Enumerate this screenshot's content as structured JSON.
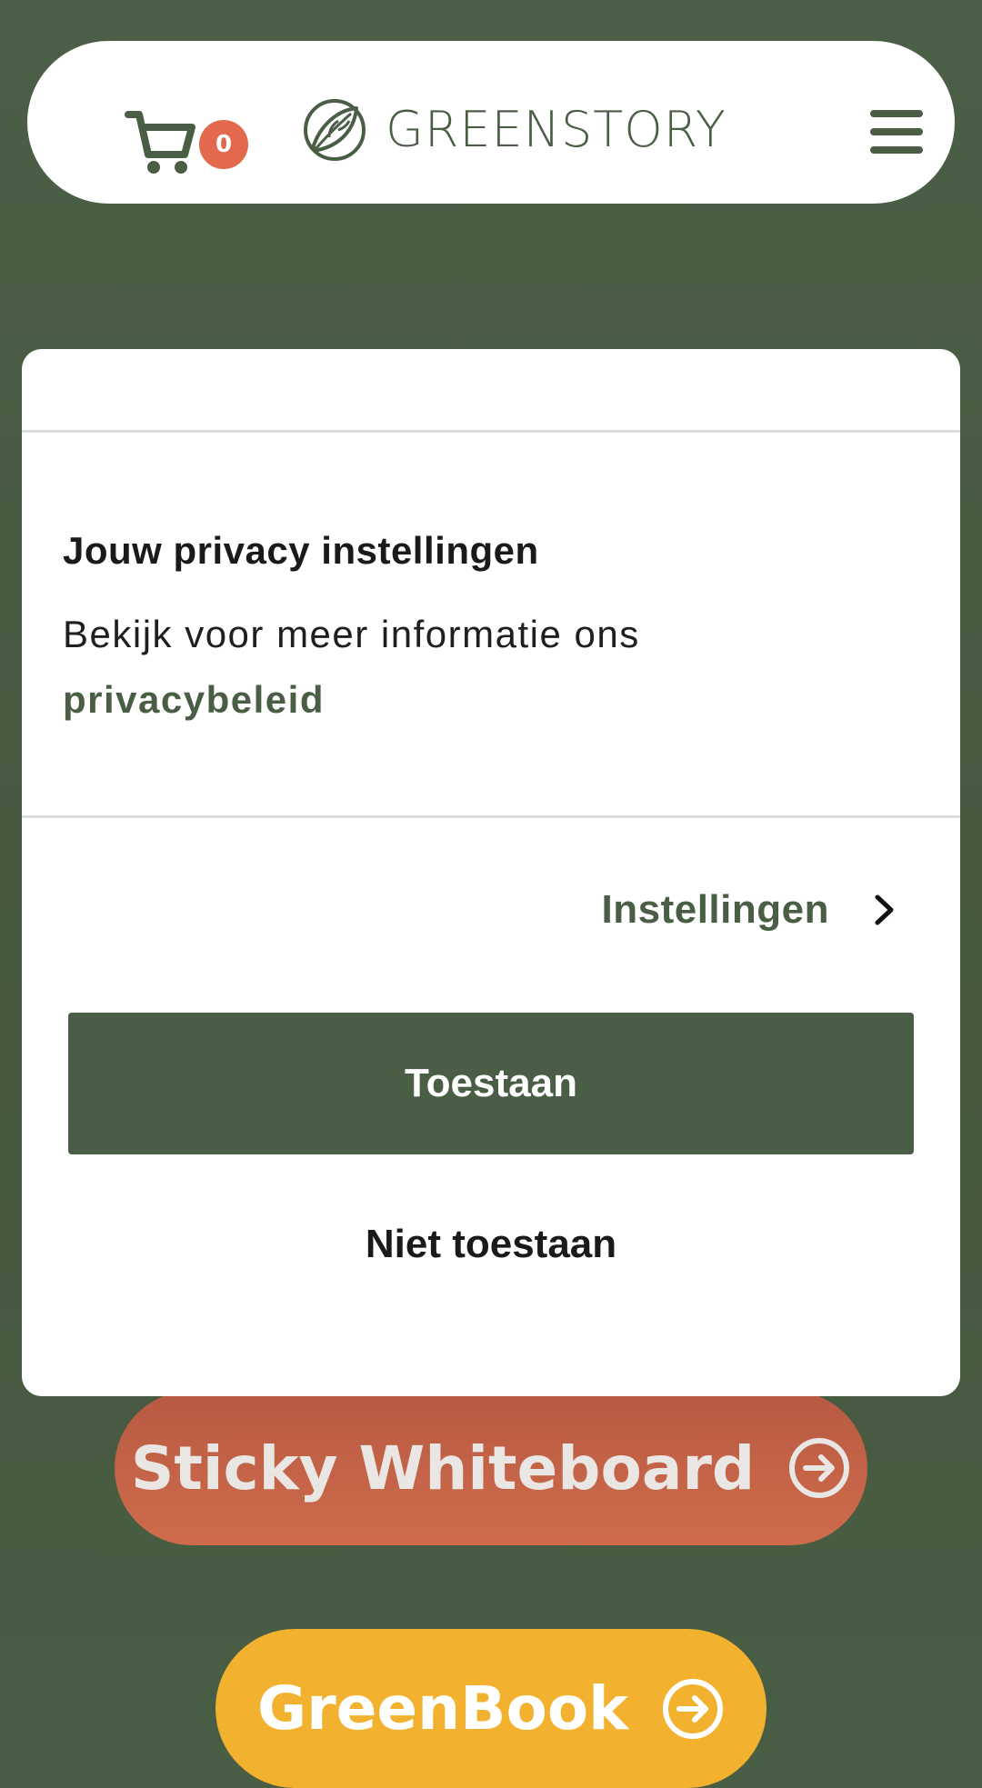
{
  "header": {
    "cart": {
      "count": "0",
      "icon": "cart-icon"
    },
    "logo": {
      "text": "GREENSTORY",
      "icon": "leaf-logo-icon"
    },
    "menu": {
      "icon": "hamburger-icon"
    }
  },
  "background_buttons": [
    {
      "label": "Sticky Whiteboard",
      "icon": "arrow-circle-right-icon",
      "color": "#cf6b4c"
    },
    {
      "label": "GreenBook",
      "icon": "arrow-circle-right-icon",
      "color": "#f2b22f"
    }
  ],
  "consent": {
    "title": "Jouw privacy instellingen",
    "text": "Bekijk voor meer informatie ons",
    "link": "privacybeleid",
    "settings_label": "Instellingen",
    "settings_icon": "chevron-right-icon",
    "allow_label": "Toestaan",
    "deny_label": "Niet toestaan"
  },
  "colors": {
    "brand_green": "#4a5e45",
    "badge": "#e2694e",
    "accent_orange": "#cf6b4c",
    "accent_yellow": "#f2b22f"
  }
}
